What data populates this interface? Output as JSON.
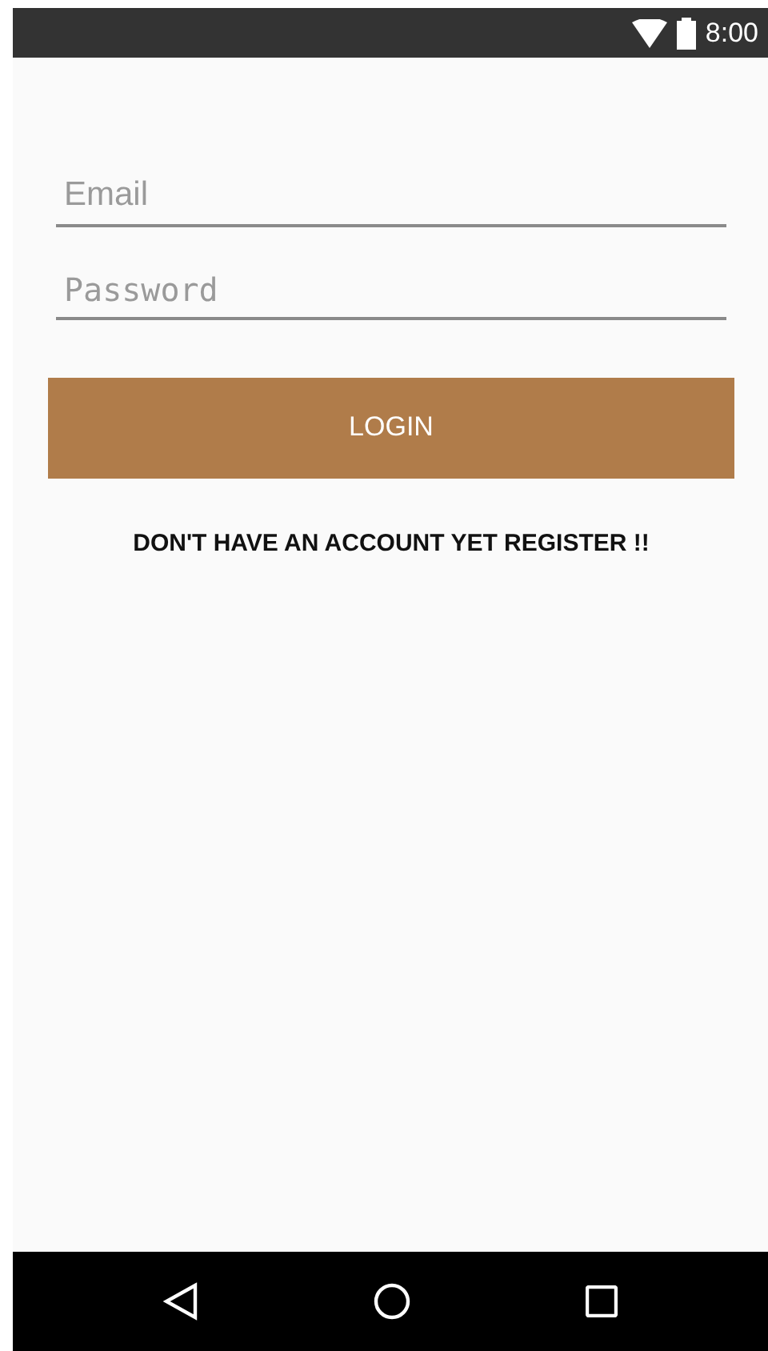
{
  "status_bar": {
    "time": "8:00"
  },
  "email_field": {
    "placeholder": "Email"
  },
  "password_field": {
    "placeholder": "Password"
  },
  "login_button": {
    "label": "LOGIN"
  },
  "register_link": {
    "label": "DON'T HAVE AN ACCOUNT YET REGISTER !!"
  }
}
